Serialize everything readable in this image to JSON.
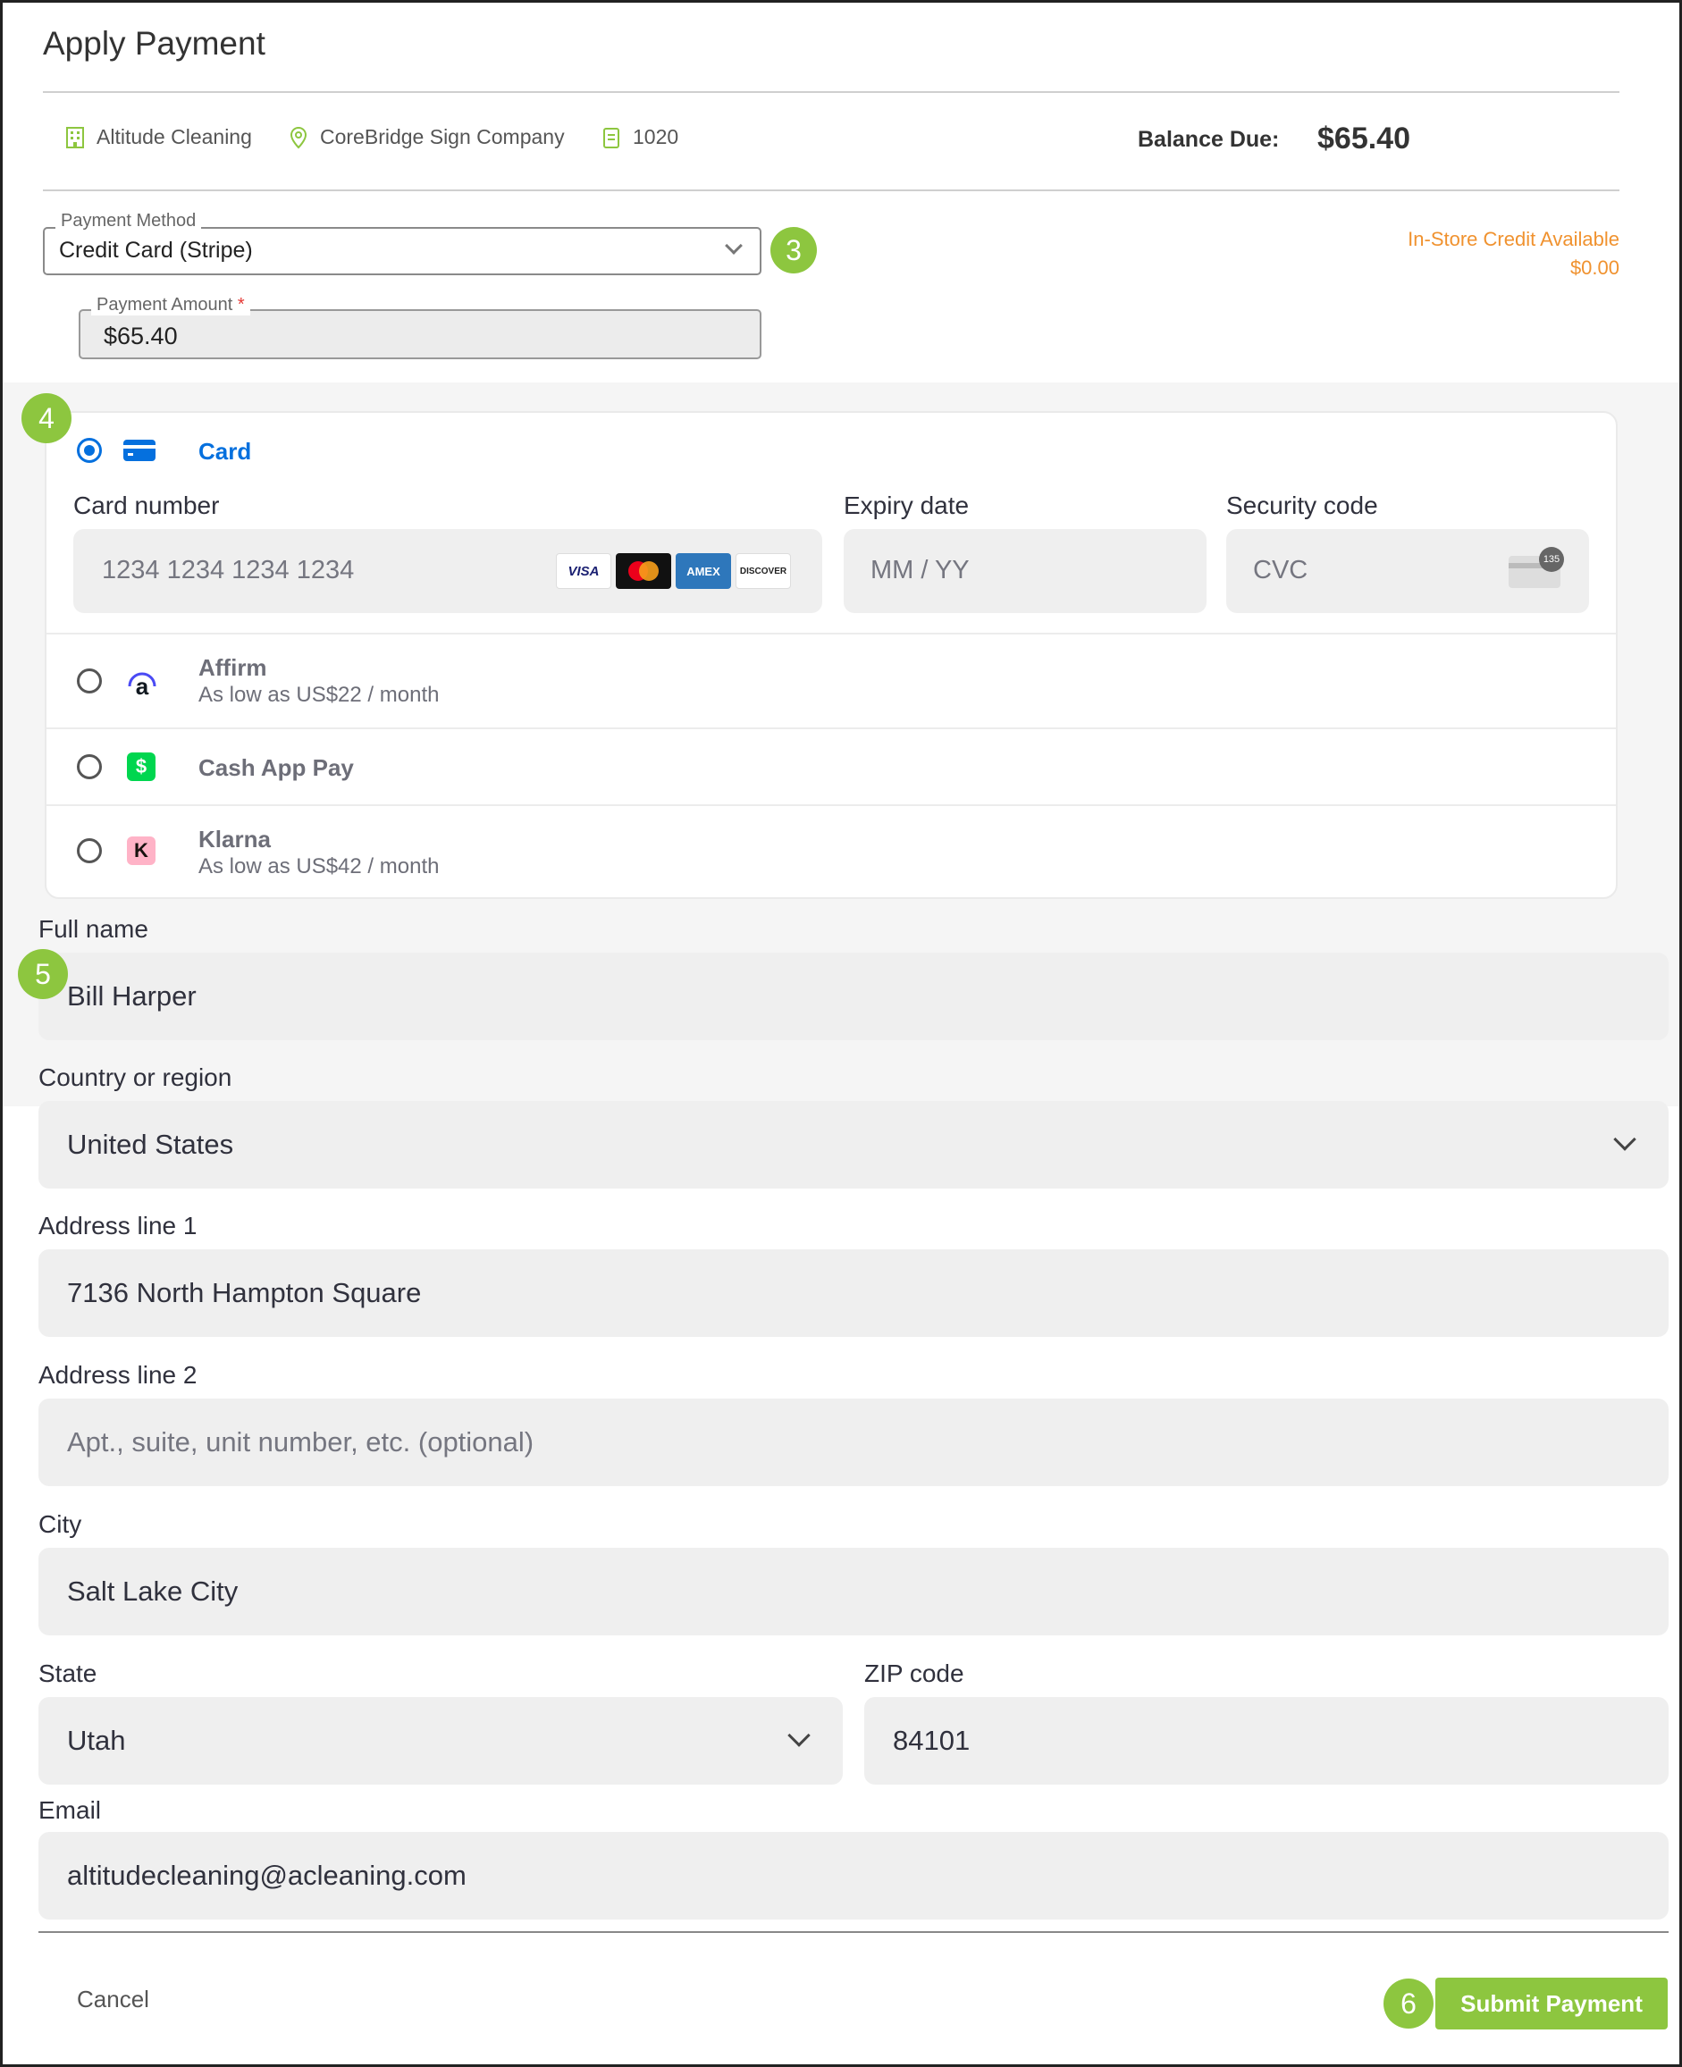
{
  "dialog": {
    "title": "Apply Payment"
  },
  "meta": {
    "company": "Altitude Cleaning",
    "location": "CoreBridge Sign Company",
    "order_number": "1020",
    "balance_label": "Balance Due:",
    "balance_value": "$65.40"
  },
  "payment_method": {
    "label": "Payment Method",
    "value": "Credit Card (Stripe)"
  },
  "payment_amount": {
    "label": "Payment Amount",
    "required_mark": "*",
    "value": "$65.40"
  },
  "credit": {
    "label": "In-Store Credit Available",
    "value": "$0.00"
  },
  "badges": {
    "b3": "3",
    "b4": "4",
    "b5": "5",
    "b6": "6"
  },
  "stripe": {
    "card_option": "Card",
    "card_number_label": "Card number",
    "card_number_placeholder": "1234 1234 1234 1234",
    "expiry_label": "Expiry date",
    "expiry_placeholder": "MM / YY",
    "cvc_label": "Security code",
    "cvc_placeholder": "CVC",
    "cvc_icon_text": "135",
    "brands": {
      "visa": "VISA",
      "amex": "AMEX",
      "discover": "DISCOVER"
    },
    "affirm": {
      "name": "Affirm",
      "sub": "As low as US$22 / month",
      "icon_letter": "a"
    },
    "cashapp": {
      "name": "Cash App Pay",
      "icon_letter": "$"
    },
    "klarna": {
      "name": "Klarna",
      "sub": "As low as US$42 / month",
      "icon_letter": "K"
    }
  },
  "billing": {
    "full_name_label": "Full name",
    "full_name_value": "Bill Harper",
    "country_label": "Country or region",
    "country_value": "United States",
    "address1_label": "Address line 1",
    "address1_value": "7136 North Hampton Square",
    "address2_label": "Address line 2",
    "address2_placeholder": "Apt., suite, unit number, etc. (optional)",
    "city_label": "City",
    "city_value": "Salt Lake City",
    "state_label": "State",
    "state_value": "Utah",
    "zip_label": "ZIP code",
    "zip_value": "84101",
    "email_label": "Email",
    "email_value": "altitudecleaning@acleaning.com"
  },
  "footer": {
    "cancel": "Cancel",
    "submit": "Submit Payment"
  },
  "colors": {
    "accent_green": "#8dc63f",
    "stripe_blue": "#0570de",
    "credit_orange": "#f0922f"
  }
}
